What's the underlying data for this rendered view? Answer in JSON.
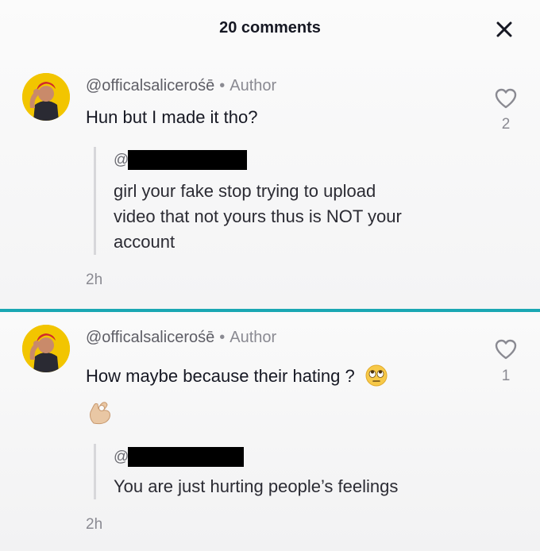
{
  "header": {
    "title": "20 comments"
  },
  "comments": [
    {
      "username": "@officalsalicerośē",
      "separator": "•",
      "badge": "Author",
      "text": "Hun but I made it tho?",
      "likes": "2",
      "reply_to": {
        "at": "@",
        "lines": [
          "girl your fake stop trying to upload",
          "video that not yours thus is NOT your",
          "account"
        ]
      },
      "time": "2h"
    },
    {
      "username": "@officalsalicerośē",
      "separator": "•",
      "badge": "Author",
      "text": "How maybe because their hating ?",
      "likes": "1",
      "reply_to": {
        "at": "@",
        "lines": [
          "You are just hurting people’s feelings"
        ]
      },
      "time": "2h"
    }
  ],
  "colors": {
    "divider": "#1aa7b3",
    "avatar_bg": "#f2c500",
    "text_primary": "#161823",
    "text_secondary": "#8a8a92"
  },
  "icons": [
    "close-icon",
    "heart-outline-icon",
    "rolling-eyes-emoji",
    "ok-hand-emoji"
  ]
}
